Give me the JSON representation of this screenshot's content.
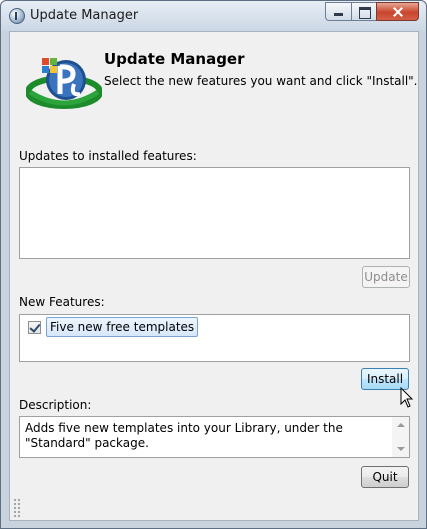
{
  "window": {
    "title": "Update Manager",
    "icon": "app-logo-icon"
  },
  "header": {
    "title": "Update Manager",
    "subtitle": "Select the new features you want and click \"Install\"."
  },
  "updates": {
    "label": "Updates to installed features:",
    "items": [],
    "button_label": "Update",
    "button_enabled": false
  },
  "new_features": {
    "label": "New Features:",
    "items": [
      {
        "label": "Five new free templates",
        "checked": true
      }
    ],
    "install_label": "Install"
  },
  "description": {
    "label": "Description:",
    "text": "Adds five new templates into your Library, under the \"Standard\" package."
  },
  "footer": {
    "quit_label": "Quit"
  },
  "colors": {
    "accent": "#3c7fb1",
    "window_frame": "#c9d3de",
    "close_button": "#c9452c"
  }
}
